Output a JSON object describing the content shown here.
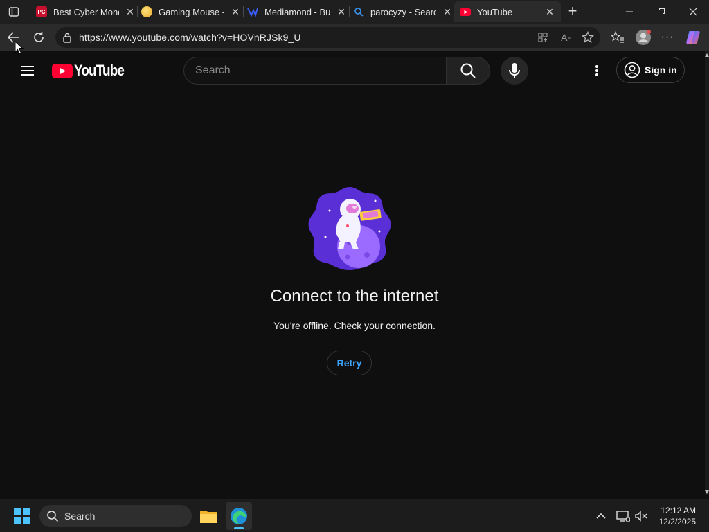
{
  "browser": {
    "tabs": [
      {
        "label": "Best Cyber Mond",
        "favicon": "pcgamer-icon",
        "color": "#c8102e"
      },
      {
        "label": "Gaming Mouse -",
        "favicon": "egg-icon",
        "color": "#f3c34a"
      },
      {
        "label": "Mediamond - Bu",
        "favicon": "mediamond-icon",
        "color": "#2b4be0"
      },
      {
        "label": "parocyzy - Searc",
        "favicon": "search-icon",
        "color": "#3a8ee6"
      },
      {
        "label": "YouTube",
        "favicon": "youtube-icon",
        "color": "#ff0033"
      }
    ],
    "active_tab_index": 4,
    "url": "https://www.youtube.com/watch?v=HOVnRJSk9_U"
  },
  "youtube": {
    "logo_text": "YouTube",
    "search_placeholder": "Search",
    "signin_label": "Sign in",
    "offline_title": "Connect to the internet",
    "offline_subtitle": "You're offline. Check your connection.",
    "retry_label": "Retry"
  },
  "taskbar": {
    "search_label": "Search",
    "time": "12:12 AM",
    "date": "12/2/2025"
  },
  "colors": {
    "yt_red": "#ff0033",
    "link_blue": "#3ea6ff",
    "background": "#0f0f0f"
  }
}
